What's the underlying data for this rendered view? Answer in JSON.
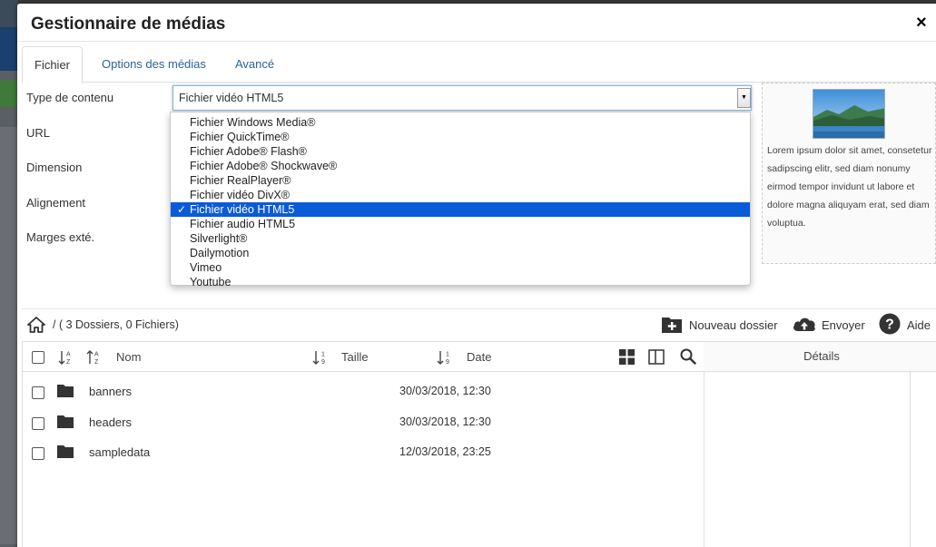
{
  "modal": {
    "title": "Gestionnaire de médias",
    "close": "×"
  },
  "tabs": [
    {
      "label": "Fichier",
      "active": true
    },
    {
      "label": "Options des médias",
      "active": false
    },
    {
      "label": "Avancé",
      "active": false
    }
  ],
  "form": {
    "content_type_label": "Type de contenu",
    "url_label": "URL",
    "dimension_label": "Dimension",
    "alignment_label": "Alignement",
    "margins_label": "Marges exté.",
    "content_type_value": "Fichier vidéo HTML5"
  },
  "dropdown": {
    "options": [
      "Fichier Windows Media®",
      "Fichier QuickTime®",
      "Fichier Adobe® Flash®",
      "Fichier Adobe® Shockwave®",
      "Fichier RealPlayer®",
      "Fichier vidéo DivX®",
      "Fichier vidéo HTML5",
      "Fichier audio HTML5",
      "Silverlight®",
      "Dailymotion",
      "Vimeo",
      "Youtube"
    ],
    "selected": "Fichier vidéo HTML5",
    "check": "✓"
  },
  "preview": {
    "text": "Lorem ipsum dolor sit amet, consetetur sadipscing elitr, sed diam nonumy eirmod tempor invidunt ut labore et dolore magna aliquyam erat, sed diam voluptua."
  },
  "browser": {
    "path": "/ ( 3 Dossiers, 0 Fichiers)",
    "new_folder": "Nouveau dossier",
    "upload": "Envoyer",
    "help": "Aide",
    "col_name": "Nom",
    "col_size": "Taille",
    "col_date": "Date",
    "details_title": "Détails",
    "rows": [
      {
        "name": "banners",
        "date": "30/03/2018, 12:30"
      },
      {
        "name": "headers",
        "date": "30/03/2018, 12:30"
      },
      {
        "name": "sampledata",
        "date": "12/03/2018, 23:25"
      }
    ]
  },
  "colors": {
    "accent": "#2a6496",
    "selected_bg": "#0a5bd6"
  }
}
